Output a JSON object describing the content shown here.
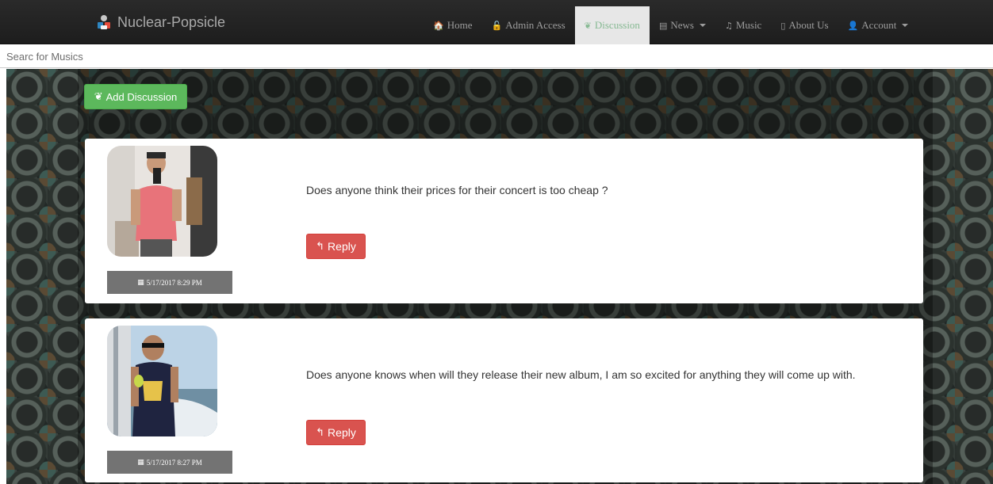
{
  "navbar": {
    "brand": "Nuclear-Popsicle",
    "items": [
      {
        "label": "Home",
        "icon": "home-icon",
        "glyph": "🏠"
      },
      {
        "label": "Admin Access",
        "icon": "unlock-icon",
        "glyph": "🔓"
      },
      {
        "label": "Discussion",
        "icon": "leaf-icon",
        "glyph": "❦",
        "active": true
      },
      {
        "label": "News",
        "icon": "newspaper-icon",
        "glyph": "▤",
        "dropdown": true
      },
      {
        "label": "Music",
        "icon": "music-icon",
        "glyph": "♫"
      },
      {
        "label": "About Us",
        "icon": "phone-icon",
        "glyph": "▯"
      },
      {
        "label": "Account",
        "icon": "user-icon",
        "glyph": "👤",
        "dropdown": true
      }
    ]
  },
  "search": {
    "placeholder": "Searc for Musics",
    "value": ""
  },
  "add_discussion": {
    "label": "Add Discussion",
    "icon": "leaf-icon",
    "glyph": "❦"
  },
  "posts": [
    {
      "text": "Does anyone think their prices for their concert is too cheap ?",
      "date": "5/17/2017 8:29 PM",
      "reply_label": "Reply"
    },
    {
      "text": "Does anyone knows when will they release their new album, I am so excited for anything they will come up with.",
      "date": "5/17/2017 8:27 PM",
      "reply_label": "Reply"
    }
  ],
  "icons": {
    "calendar": "▦",
    "reply": "↰"
  },
  "colors": {
    "navbar": "#222222",
    "active_tab": "#e7e7e7",
    "success": "#5cb85c",
    "danger": "#d9534f",
    "date_badge": "#737373"
  }
}
